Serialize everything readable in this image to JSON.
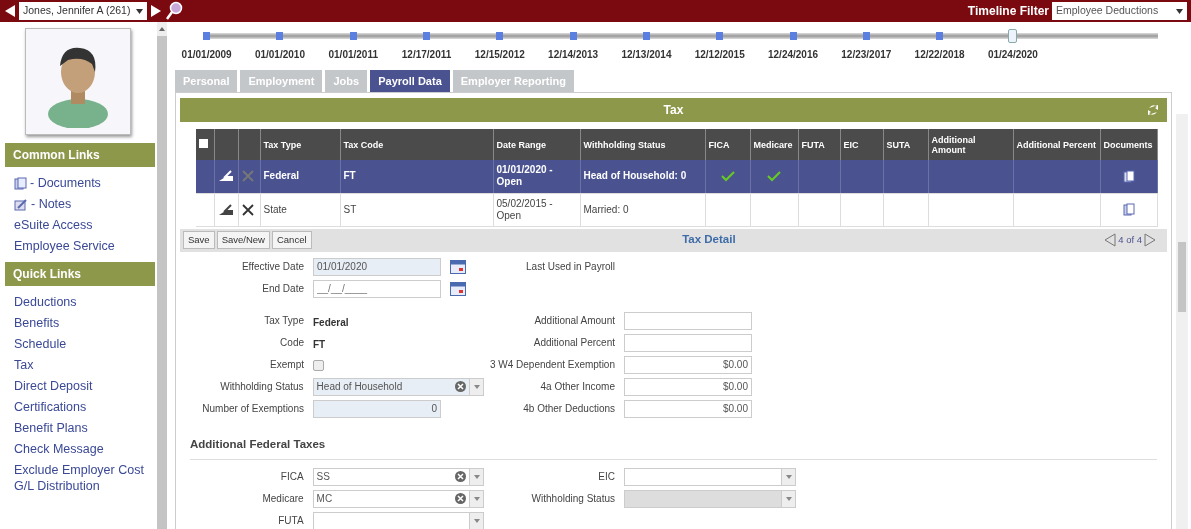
{
  "top_bar": {
    "employee": "Jones, Jennifer A (261)",
    "filter_label": "Timeline Filter",
    "filter_value": "Employee Deductions"
  },
  "sidebar": {
    "sections": [
      {
        "title": "Common Links",
        "items": [
          {
            "label": "- Documents",
            "kind": "documents"
          },
          {
            "label": "- Notes",
            "kind": "notes"
          },
          {
            "label": "eSuite Access",
            "kind": "link"
          },
          {
            "label": "Employee Service",
            "kind": "link"
          }
        ]
      },
      {
        "title": "Quick Links",
        "items": [
          {
            "label": "Deductions",
            "kind": "link"
          },
          {
            "label": "Benefits",
            "kind": "link"
          },
          {
            "label": "Schedule",
            "kind": "link"
          },
          {
            "label": "Tax",
            "kind": "link"
          },
          {
            "label": "Direct Deposit",
            "kind": "link"
          },
          {
            "label": "Certifications",
            "kind": "link"
          },
          {
            "label": "Benefit Plans",
            "kind": "link"
          },
          {
            "label": "Check Message",
            "kind": "link"
          },
          {
            "label": "Exclude Employer Cost G/L Distribution",
            "kind": "link"
          }
        ]
      }
    ]
  },
  "timeline": {
    "dates": [
      {
        "label": "01/01/2009",
        "selected": false
      },
      {
        "label": "01/01/2010",
        "selected": false
      },
      {
        "label": "01/01/2011",
        "selected": false
      },
      {
        "label": "12/17/2011",
        "selected": false
      },
      {
        "label": "12/15/2012",
        "selected": false
      },
      {
        "label": "12/14/2013",
        "selected": false
      },
      {
        "label": "12/13/2014",
        "selected": false
      },
      {
        "label": "12/12/2015",
        "selected": false
      },
      {
        "label": "12/24/2016",
        "selected": false
      },
      {
        "label": "12/23/2017",
        "selected": false
      },
      {
        "label": "12/22/2018",
        "selected": false
      },
      {
        "label": "01/24/2020",
        "selected": true
      }
    ]
  },
  "tabs": [
    {
      "label": "Personal",
      "selected": false
    },
    {
      "label": "Employment",
      "selected": false
    },
    {
      "label": "Jobs",
      "selected": false
    },
    {
      "label": "Payroll Data",
      "selected": true
    },
    {
      "label": "Employer Reporting",
      "selected": false
    }
  ],
  "panel": {
    "title": "Tax",
    "table": {
      "select_all_checked": false,
      "columns": [
        "Tax Type",
        "Tax Code",
        "Date Range",
        "Withholding Status",
        "FICA",
        "Medicare",
        "FUTA",
        "EIC",
        "SUTA",
        "Additional Amount",
        "Additional Percent",
        "Documents"
      ],
      "rows": [
        {
          "selected": true,
          "tax_type": "Federal",
          "tax_code": "FT",
          "date_range": "01/01/2020 - Open",
          "withholding_status": "Head of Household: 0",
          "fica": true,
          "medicare": true
        },
        {
          "selected": false,
          "tax_type": "State",
          "tax_code": "ST",
          "date_range": "05/02/2015 - Open",
          "withholding_status": "Married: 0",
          "fica": false,
          "medicare": false
        }
      ]
    },
    "toolbar": {
      "buttons": [
        "Save",
        "Save/New",
        "Cancel"
      ],
      "title": "Tax Detail",
      "pager": "4 of 4"
    },
    "groups": [
      {
        "left": [
          {
            "label": "Effective Date",
            "kind": "date",
            "value": "01/01/2020",
            "readonly": true
          },
          {
            "label": "End Date",
            "kind": "date",
            "placeholder": "__/__/____",
            "readonly": false
          }
        ],
        "right": [
          {
            "label": "Last Used in Payroll",
            "kind": "label"
          }
        ]
      },
      {
        "left": [
          {
            "label": "Tax Type",
            "kind": "static",
            "value": "Federal"
          },
          {
            "label": "Code",
            "kind": "static",
            "value": "FT"
          },
          {
            "label": "Exempt",
            "kind": "checkbox",
            "checked": false
          },
          {
            "label": "Withholding Status",
            "kind": "combo",
            "value": "Head of Household",
            "readonly": true,
            "clearable": true
          },
          {
            "label": "Number of Exemptions",
            "kind": "number",
            "value": "0",
            "readonly": true
          }
        ],
        "right": [
          {
            "label": "Additional Amount",
            "kind": "number",
            "readonly": false
          },
          {
            "label": "Additional Percent",
            "kind": "number",
            "readonly": false
          },
          {
            "label": "3 W4 Dependent Exemption",
            "kind": "number",
            "value": "$0.00",
            "readonly": false
          },
          {
            "label": "4a Other Income",
            "kind": "number",
            "value": "$0.00",
            "readonly": false
          },
          {
            "label": "4b Other Deductions",
            "kind": "number",
            "value": "$0.00",
            "readonly": false
          }
        ]
      }
    ],
    "section_title": "Additional Federal Taxes",
    "section": {
      "left": [
        {
          "label": "FICA",
          "kind": "combo",
          "value": "SS",
          "readonly": false,
          "clearable": true
        },
        {
          "label": "Medicare",
          "kind": "combo",
          "value": "MC",
          "readonly": false,
          "clearable": true
        },
        {
          "label": "FUTA",
          "kind": "combo",
          "readonly": false,
          "clearable": false
        }
      ],
      "right": [
        {
          "label": "EIC",
          "kind": "select",
          "disabled": false
        },
        {
          "label": "Withholding Status",
          "kind": "select",
          "disabled": true
        }
      ]
    }
  }
}
